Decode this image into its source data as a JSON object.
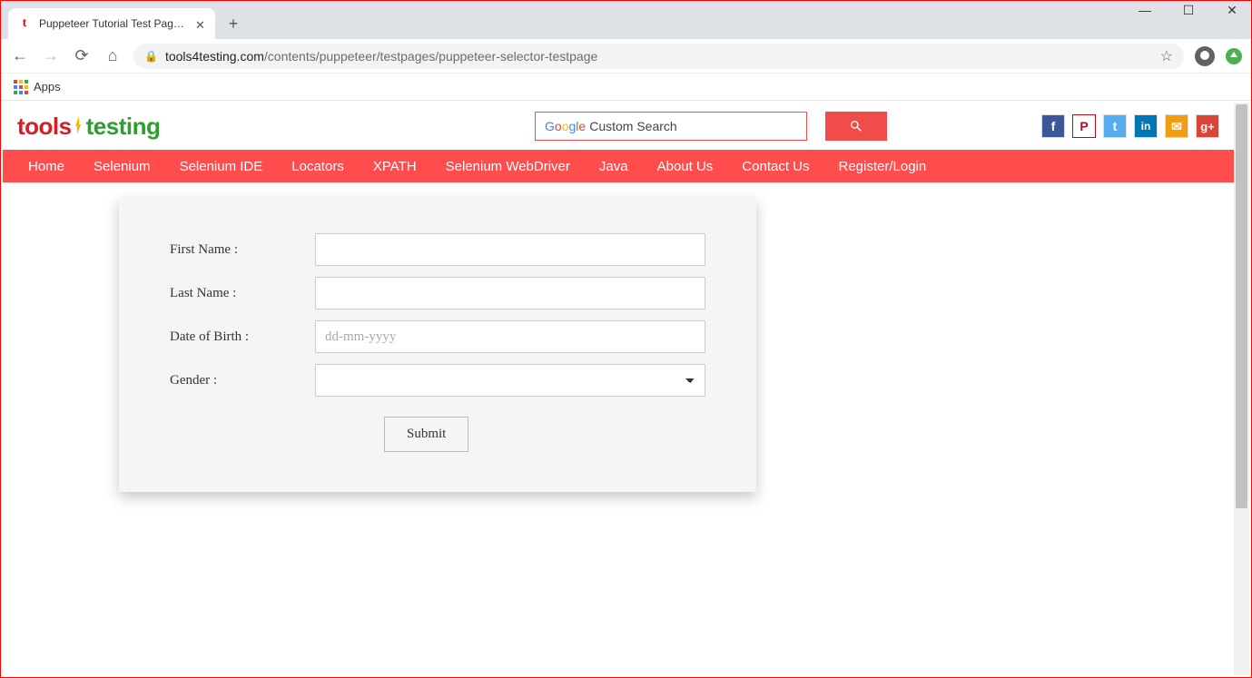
{
  "browser": {
    "tab_title": "Puppeteer Tutorial Test Page - to",
    "favicon_letter": "t",
    "url_domain": "tools4testing.com",
    "url_path": "/contents/puppeteer/testpages/puppeteer-selector-testpage",
    "apps_label": "Apps"
  },
  "logo": {
    "part1": "tools",
    "part2": "testing"
  },
  "search": {
    "google_label": "Google",
    "placeholder": "Custom Search"
  },
  "nav": {
    "items": [
      "Home",
      "Selenium",
      "Selenium IDE",
      "Locators",
      "XPATH",
      "Selenium WebDriver",
      "Java",
      "About Us",
      "Contact Us",
      "Register/Login"
    ]
  },
  "form": {
    "first_name_label": "First Name :",
    "last_name_label": "Last Name :",
    "dob_label": "Date of Birth :",
    "dob_placeholder": "dd-mm-yyyy",
    "gender_label": "Gender :",
    "submit_label": "Submit"
  },
  "social": {
    "fb": "f",
    "pin": "P",
    "tw": "t",
    "in": "in",
    "mail": "✉",
    "gp": "g+"
  }
}
